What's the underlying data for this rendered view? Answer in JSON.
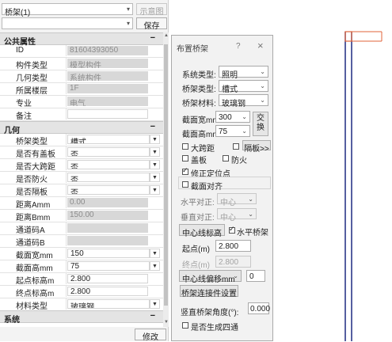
{
  "top": {
    "family_select": "桥架(1)",
    "diagram_button": "示意图",
    "type_select": "",
    "save_button": "保存"
  },
  "sections": {
    "common": "公共属性",
    "geometry": "几何",
    "system": "系统",
    "collapse": "−"
  },
  "common_rows": [
    {
      "label": "ID",
      "value": "81604393050"
    },
    {
      "label": "构件类型",
      "value": "模型构件"
    },
    {
      "label": "几何类型",
      "value": "系统构件"
    },
    {
      "label": "所属楼层",
      "value": "1F"
    },
    {
      "label": "专业",
      "value": "电气"
    },
    {
      "label": "备注",
      "value": ""
    }
  ],
  "geometry_rows": [
    {
      "label": "桥架类型",
      "value": "槽式"
    },
    {
      "label": "是否有盖板",
      "value": "否"
    },
    {
      "label": "是否大跨距",
      "value": "否"
    },
    {
      "label": "是否防火",
      "value": "否"
    },
    {
      "label": "是否隔板",
      "value": "否"
    },
    {
      "label": "距离Amm",
      "value": "0.00"
    },
    {
      "label": "距离Bmm",
      "value": "150.00"
    },
    {
      "label": "通道码A",
      "value": ""
    },
    {
      "label": "通道码B",
      "value": ""
    },
    {
      "label": "截面宽mm",
      "value": "150"
    },
    {
      "label": "截面高mm",
      "value": "75"
    },
    {
      "label": "起点标高m",
      "value": "2.800"
    },
    {
      "label": "终点标高m",
      "value": "2.800"
    },
    {
      "label": "材料类型",
      "value": "玻璃钢"
    }
  ],
  "modify_button": "修改",
  "dialog": {
    "title": "布置桥架",
    "help": "?",
    "close": "×",
    "system_type_label": "系统类型:",
    "system_type": "照明",
    "tray_type_label": "桥架类型:",
    "tray_type": "槽式",
    "material_label": "桥架材料:",
    "material": "玻璃钢",
    "width_label": "截面宽mm:",
    "width": "300",
    "height_label": "截面高mm:",
    "height": "75",
    "swap_button": "交换",
    "large_span": "大跨距",
    "partition_button": "隔板>>",
    "cover": "盖板",
    "fireproof": "防火",
    "fix_point": "修正定位点",
    "section_align": "截面对齐",
    "h_align_label": "水平对正:",
    "h_align": "中心",
    "v_align_label": "垂直对正:",
    "v_align": "中心",
    "elev_mode": "中心线标高",
    "horizontal_tray": "水平桥架",
    "start_label": "起点(m)",
    "start_value": "2.800",
    "end_label": "终点(m)",
    "end_value": "2.800",
    "offset_mode": "中心线偏移mm",
    "offset_value": "0",
    "connector_button": "桥架连接件设置",
    "vert_angle_label": "竖直桥架角度(°):",
    "vert_angle": "0.000",
    "four_way": "是否生成四通"
  }
}
